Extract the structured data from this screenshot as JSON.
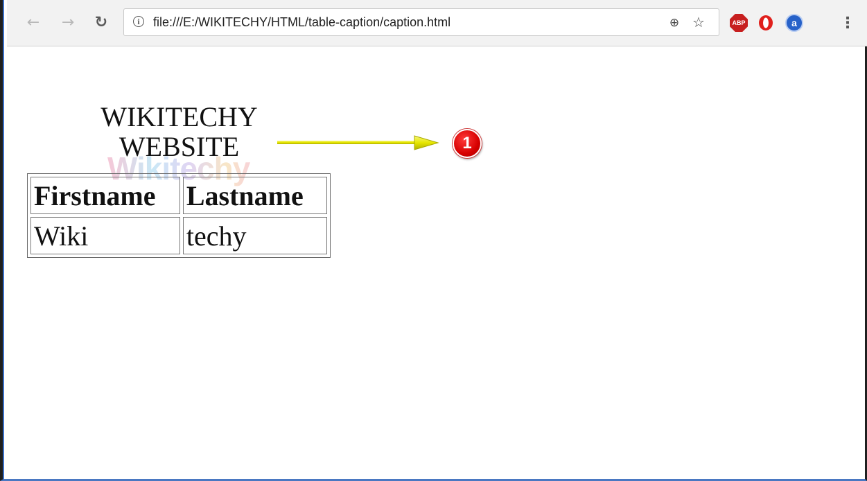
{
  "browser": {
    "url": "file:///E:/WIKITECHY/HTML/table-caption/caption.html",
    "back_icon": "arrow-left",
    "forward_icon": "arrow-right",
    "reload_icon": "reload",
    "extensions": {
      "abp_label": "ABP",
      "ext_a_label": "a"
    }
  },
  "page": {
    "caption_line1": "WIKITECHY",
    "caption_line2": "WEBSITE",
    "watermark": "Wikitechy",
    "table": {
      "headers": [
        "Firstname",
        "Lastname"
      ],
      "rows": [
        [
          "Wiki",
          "techy"
        ]
      ]
    }
  },
  "annotation": {
    "badge_number": "1",
    "arrow_color": "#e8e800",
    "badge_color": "#d60000"
  }
}
